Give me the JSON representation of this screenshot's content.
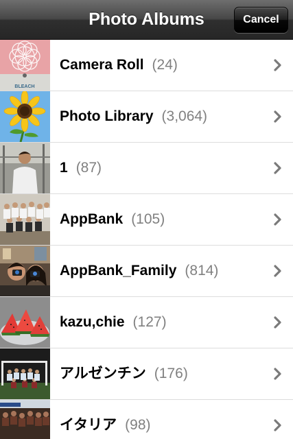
{
  "navbar": {
    "title": "Photo Albums",
    "cancel_label": "Cancel"
  },
  "albums": [
    {
      "name": "Camera Roll",
      "count": "(24)",
      "thumb": "bleach-photo"
    },
    {
      "name": "Photo Library",
      "count": "(3,064)",
      "thumb": "sunflower-photo"
    },
    {
      "name": "1",
      "count": "(87)",
      "thumb": "man-portrait-photo"
    },
    {
      "name": "AppBank",
      "count": "(105)",
      "thumb": "group-photo"
    },
    {
      "name": "AppBank_Family",
      "count": "(814)",
      "thumb": "couple-camera-photo"
    },
    {
      "name": "kazu,chie",
      "count": "(127)",
      "thumb": "watermelon-photo"
    },
    {
      "name": "アルゼンチン",
      "count": "(176)",
      "thumb": "team-photo"
    },
    {
      "name": "イタリア",
      "count": "(98)",
      "thumb": "crowd-photo"
    }
  ],
  "thumb_text": {
    "bleach": "BLEACH"
  },
  "icons": {
    "row_disclosure": "chevron-right-icon"
  }
}
